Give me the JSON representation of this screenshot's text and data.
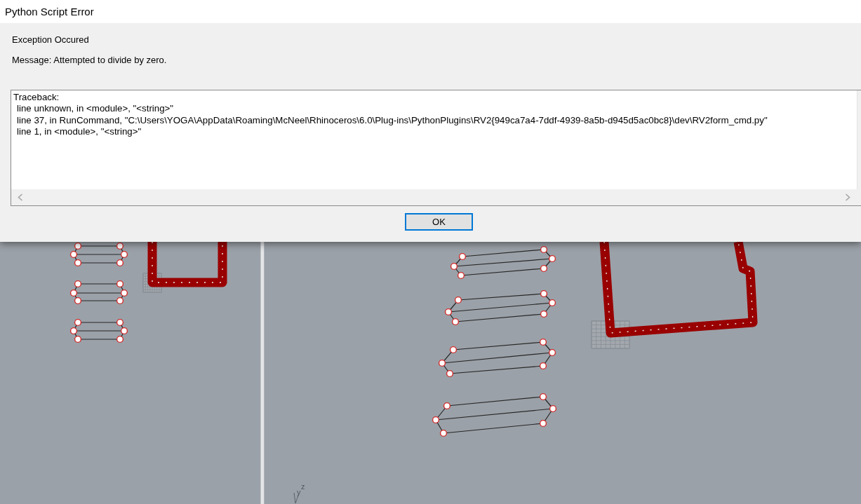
{
  "dialog": {
    "title": "Python Script Error",
    "heading": "Exception Occured",
    "message": "Message: Attempted to divide by zero.",
    "traceback": {
      "heading": "Traceback:",
      "lines": [
        "line unknown, in <module>, \"<string>\"",
        "line 37, in RunCommand, \"C:\\Users\\YOGA\\AppData\\Roaming\\McNeel\\Rhinoceros\\6.0\\Plug-ins\\PythonPlugins\\RV2{949ca7a4-7ddf-4939-8a5b-d945d5ac0bc8}\\dev\\RV2form_cmd.py\"",
        "line 1, in <module>, \"<string>\""
      ]
    },
    "buttons": [
      {
        "label": "OK",
        "focused": true
      }
    ]
  },
  "right_viewport": {
    "axis_labels": [
      "y",
      "z"
    ]
  }
}
